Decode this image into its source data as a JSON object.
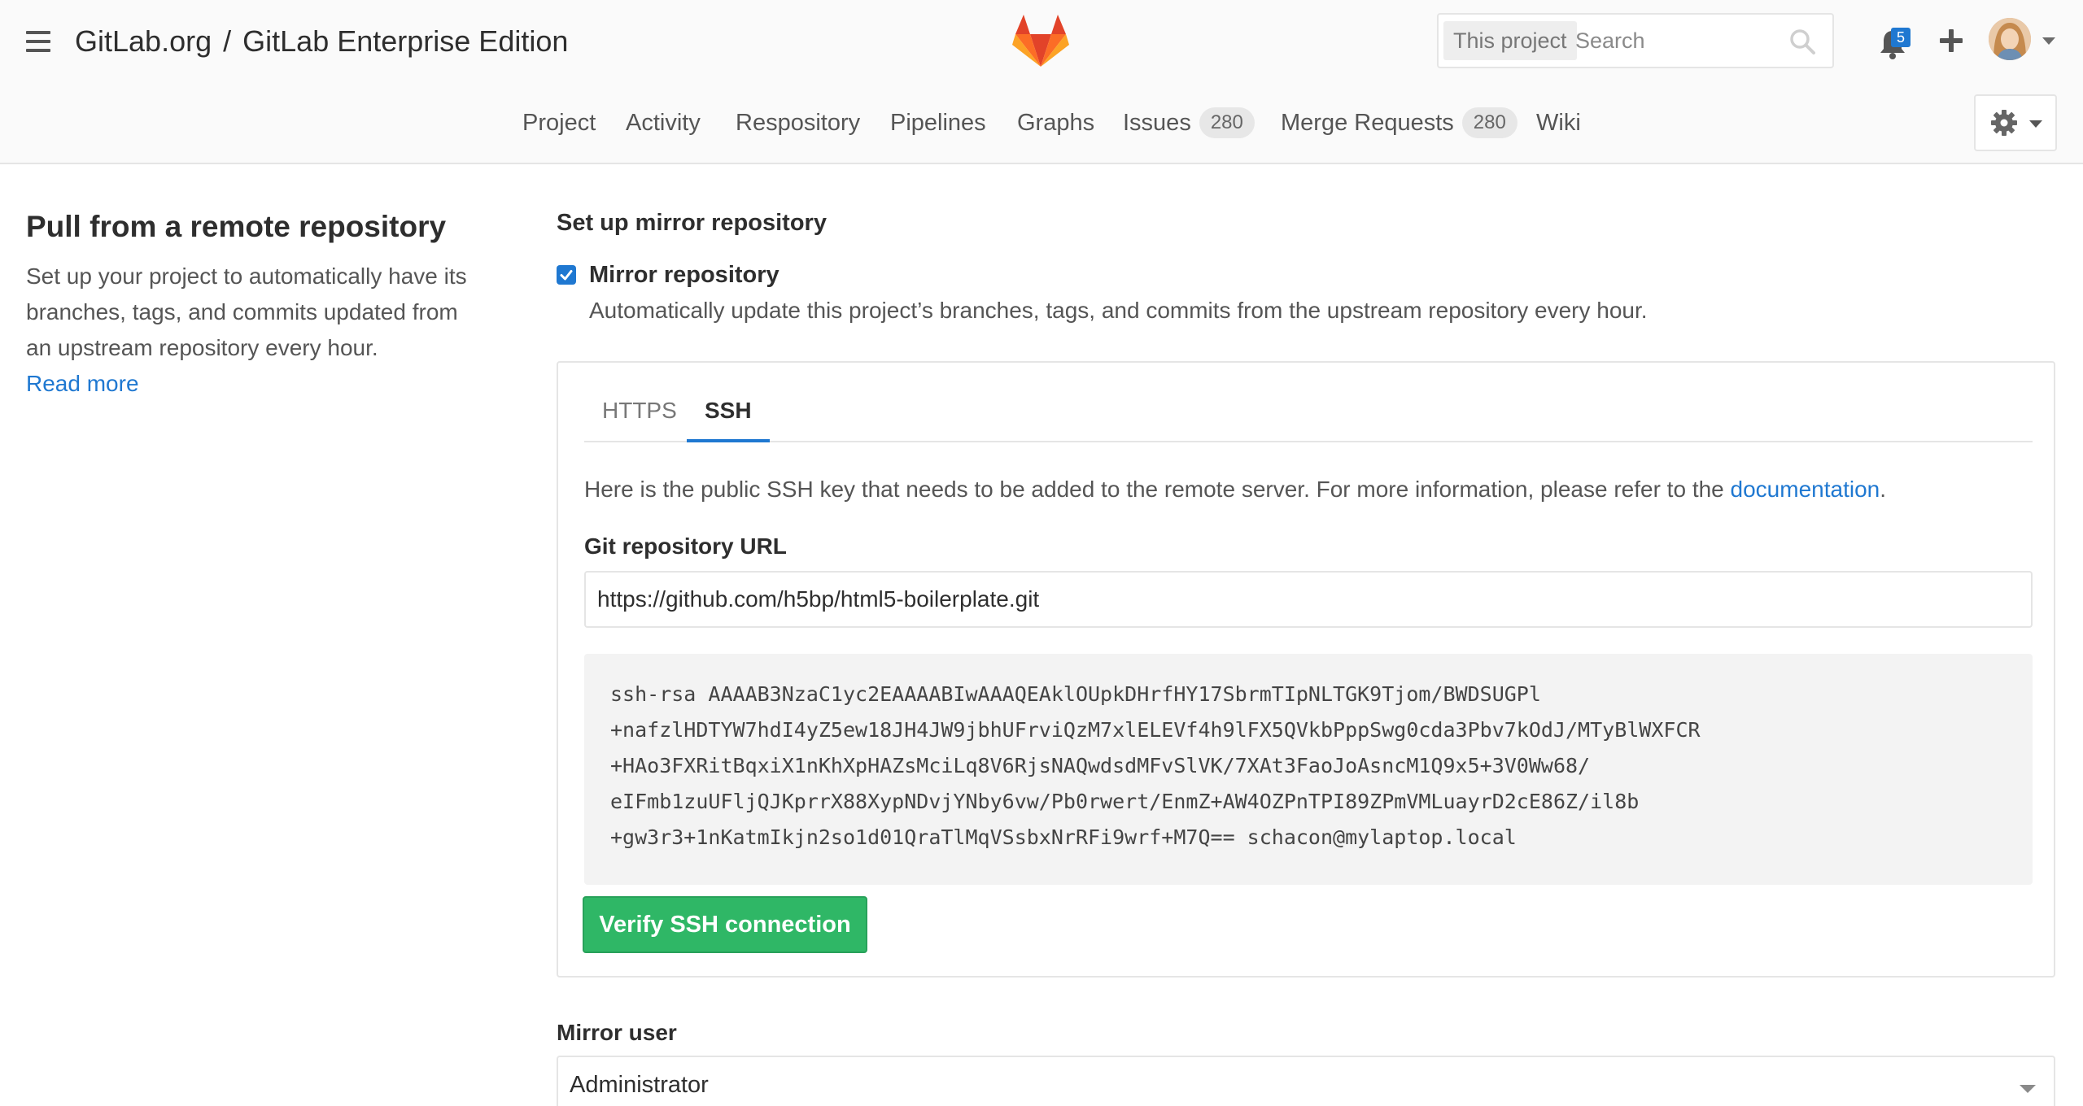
{
  "header": {
    "group": "GitLab.org",
    "separator": "/",
    "project": "GitLab Enterprise Edition",
    "logo_icon": "gitlab-tanuki-icon",
    "search_scope": "This project",
    "search_placeholder": "Search",
    "notification_count": "5"
  },
  "nav": {
    "project": "Project",
    "activity": "Activity",
    "repository": "Respository",
    "pipelines": "Pipelines",
    "graphs": "Graphs",
    "issues": "Issues",
    "issues_count": "280",
    "merge_requests": "Merge Requests",
    "merge_requests_count": "280",
    "wiki": "Wiki"
  },
  "sidebar": {
    "title": "Pull from a remote repository",
    "description": "Set up your project to automatically have its branches, tags, and commits updated from an upstream repository every hour.",
    "read_more": "Read more"
  },
  "main": {
    "section_title": "Set up mirror repository",
    "mirror_checkbox_label": "Mirror repository",
    "mirror_checked": true,
    "mirror_help": "Automatically update this project’s branches, tags, and commits from the upstream repository every hour.",
    "tabs": [
      {
        "label": "HTTPS",
        "active": false
      },
      {
        "label": "SSH",
        "active": true
      }
    ],
    "ssh_info_prefix": "Here is the public SSH key that needs to be added to the remote server. For more information, please refer to the ",
    "ssh_info_link": "documentation",
    "ssh_info_suffix": ".",
    "url_label": "Git repository URL",
    "url_value": "https://github.com/h5bp/html5-boilerplate.git",
    "ssh_key_lines": [
      "ssh-rsa AAAAB3NzaC1yc2EAAAABIwAAAQEAklOUpkDHrfHY17SbrmTIpNLTGK9Tjom/BWDSUGPl",
      "+nafzlHDTYW7hdI4yZ5ew18JH4JW9jbhUFrviQzM7xlELEVf4h9lFX5QVkbPppSwg0cda3Pbv7kOdJ/MTyBlWXFCR",
      "+HAo3FXRitBqxiX1nKhXpHAZsMciLq8V6RjsNAQwdsdMFvSlVK/7XAt3FaoJoAsncM1Q9x5+3V0Ww68/",
      "eIFmb1zuUFljQJKprrX88XypNDvjYNby6vw/Pb0rwert/EnmZ+AW4OZPnTPI89ZPmVMLuayrD2cE86Z/il8b",
      "+gw3r3+1nKatmIkjn2so1d01QraTlMqVSsbxNrRFi9wrf+M7Q== schacon@mylaptop.local"
    ],
    "verify_button": "Verify SSH connection",
    "mirror_user_label": "Mirror user",
    "mirror_user_value": "Administrator"
  },
  "colors": {
    "accent": "#1f78d1",
    "success": "#2fb766",
    "logo_orange": "#fc6d26",
    "logo_red": "#e24329",
    "logo_light": "#fca326"
  }
}
